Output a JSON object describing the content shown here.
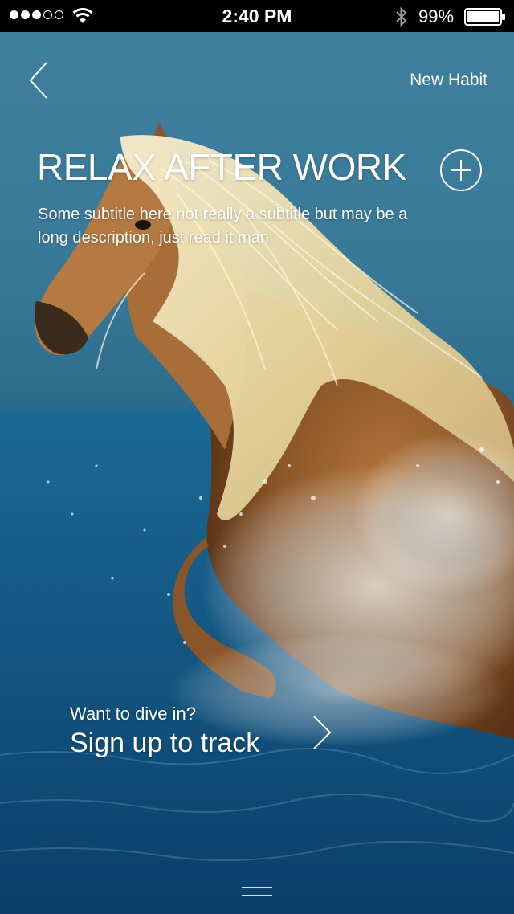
{
  "status_bar": {
    "time": "2:40 PM",
    "battery_percent": "99%",
    "signal_bars_filled": 3,
    "signal_bars_total": 5,
    "icons": [
      "signal-dots-icon",
      "wifi-icon",
      "bluetooth-icon",
      "battery-icon"
    ]
  },
  "nav": {
    "back_icon": "chevron-left-icon",
    "new_habit_label": "New Habit"
  },
  "habit": {
    "title": "RELAX AFTER WORK",
    "subtitle": "Some subtitle here not really a subtitle but may be a long description, just read it man",
    "add_icon": "plus-circle-icon"
  },
  "cta": {
    "question": "Want to dive in?",
    "action": "Sign up to track",
    "icon": "chevron-right-icon"
  },
  "bottom": {
    "handle_icon": "menu-handle-icon"
  },
  "colors": {
    "status_bar_bg": "#000000",
    "text": "#ffffff",
    "sky": "#3f7e9e",
    "sea": "#175a88"
  }
}
